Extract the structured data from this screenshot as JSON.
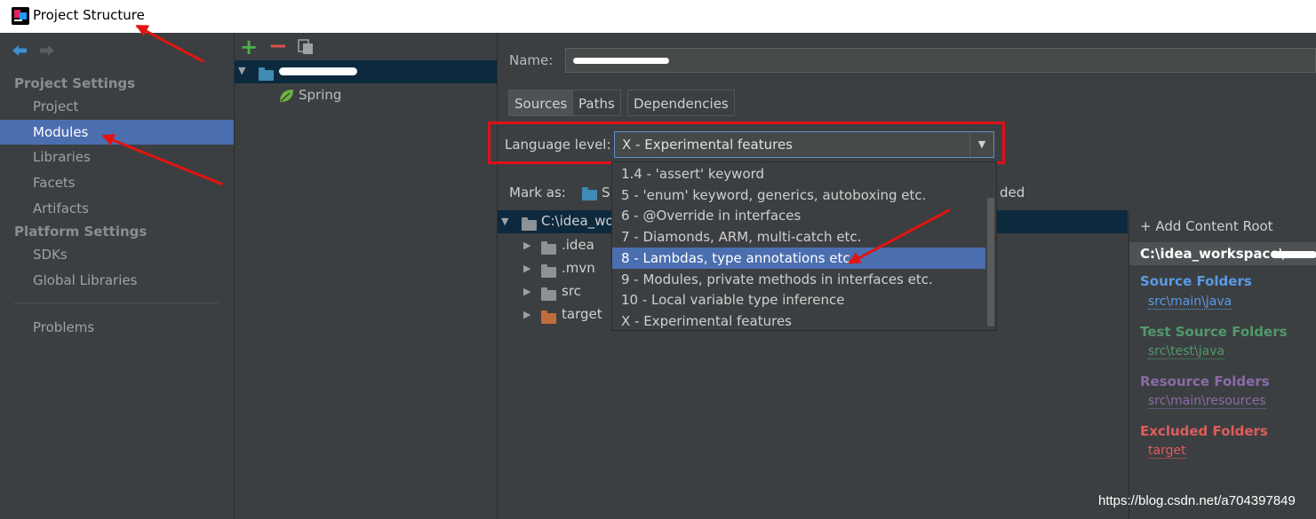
{
  "window": {
    "title": "Project Structure"
  },
  "nav": {
    "back_icon": "arrow-left-icon",
    "forward_icon": "arrow-right-icon",
    "project_settings_header": "Project Settings",
    "project_settings": [
      "Project",
      "Modules",
      "Libraries",
      "Facets",
      "Artifacts"
    ],
    "platform_settings_header": "Platform Settings",
    "platform_settings": [
      "SDKs",
      "Global Libraries"
    ],
    "problems": "Problems",
    "selected": "Modules"
  },
  "module_tree": {
    "toolbar": {
      "add": "+",
      "remove": "−"
    },
    "facet": "Spring"
  },
  "module": {
    "name_label": "Name:",
    "tabs": [
      "Sources",
      "Paths",
      "Dependencies"
    ],
    "active_tab": "Sources",
    "language_level_label": "Language level:",
    "language_level_value": "X - Experimental features",
    "mark_as_label": "Mark as:",
    "mark_as_tail": "ded",
    "mark_as_partial": "S",
    "content_root_partial": "C:\\idea_wo",
    "folders": [
      ".idea",
      ".mvn",
      "src",
      "target"
    ]
  },
  "language_levels": [
    "1.4 - 'assert' keyword",
    "5 - 'enum' keyword, generics, autoboxing etc.",
    "6 - @Override in interfaces",
    "7 - Diamonds, ARM, multi-catch etc.",
    "8 - Lambdas, type annotations etc.",
    "9 - Modules, private methods in interfaces etc.",
    "10 - Local variable type inference",
    "X - Experimental features"
  ],
  "language_levels_selected_index": 4,
  "content_roots": {
    "add_label": "+ Add Content Root",
    "root_path": "C:\\idea_workspace\\",
    "sections": [
      {
        "title": "Source Folders",
        "path": "src\\main\\java",
        "color": "#5a9ae6"
      },
      {
        "title": "Test Source Folders",
        "path": "src\\test\\java",
        "color": "#4f9a6a"
      },
      {
        "title": "Resource Folders",
        "path": "src\\main\\resources",
        "color": "#8b6ba8"
      },
      {
        "title": "Excluded Folders",
        "path": "target",
        "color": "#e05c5c"
      }
    ]
  },
  "colors": {
    "selection": "#4b6eaf",
    "annotation_red": "#e3140f"
  },
  "watermark": "https://blog.csdn.net/a704397849"
}
